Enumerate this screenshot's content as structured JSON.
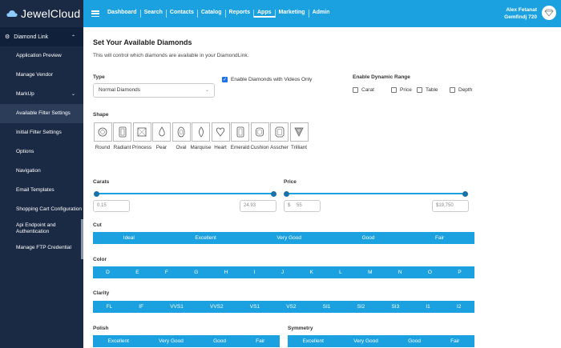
{
  "brand": {
    "name_a": "Jewel",
    "name_b": "Cloud"
  },
  "nav": [
    "Dashboard",
    "Search",
    "Contacts",
    "Catalog",
    "Reports",
    "Apps",
    "Marketing",
    "Admin"
  ],
  "user": {
    "name": "Alex Fetanat",
    "company": "Gemfindj 720"
  },
  "sidebar": {
    "header": "Diamond Link",
    "items": [
      {
        "label": "Application Preview"
      },
      {
        "label": "Manage Vendor"
      },
      {
        "label": "MarkUp"
      },
      {
        "label": "Available Filter Settings"
      },
      {
        "label": "Initial Filter Settings"
      },
      {
        "label": "Options"
      },
      {
        "label": "Navigation"
      },
      {
        "label": "Email Templates"
      },
      {
        "label": "Shopping Cart Configuration"
      },
      {
        "label": "Api Endpoint and Authentication"
      },
      {
        "label": "Manage FTP Credential"
      }
    ]
  },
  "main": {
    "title": "Set Your Available Diamonds",
    "description": "This will control which diamonds are available in your DiamondLink.",
    "type_label": "Type",
    "type_value": "Normal Diamonds",
    "videos_label": "Enable Diamonds with Videos Only",
    "dynamic_label": "Enable Dynamic Range",
    "dynamic_opts": [
      "Carat",
      "Price",
      "Table",
      "Depth"
    ],
    "shape_label": "Shape",
    "shapes": [
      "Round",
      "Radiant",
      "Princess",
      "Pear",
      "Oval",
      "Marquise",
      "Heart",
      "Emerald",
      "Cushion",
      "Asscher",
      "Trilliant"
    ],
    "carats_label": "Carats",
    "carat_min": "0.15",
    "carat_max": "24.93",
    "price_label": "Price",
    "price_currency": "$",
    "price_min": "55",
    "price_max": "$19,750",
    "cut_label": "Cut",
    "cut": [
      "Ideal",
      "Excellent",
      "Very Good",
      "Good",
      "Fair"
    ],
    "color_label": "Color",
    "color": [
      "D",
      "E",
      "F",
      "G",
      "H",
      "I",
      "J",
      "K",
      "L",
      "M",
      "N",
      "O",
      "P"
    ],
    "clarity_label": "Clarity",
    "clarity": [
      "FL",
      "IF",
      "VVS1",
      "VVS2",
      "VS1",
      "VS2",
      "SI1",
      "SI2",
      "SI3",
      "I1",
      "I2"
    ],
    "polish_label": "Polish",
    "polish": [
      "Excellent",
      "Very Good",
      "Good",
      "Fair"
    ],
    "symmetry_label": "Symmetry",
    "symmetry": [
      "Excellent",
      "Very Good",
      "Good",
      "Fair"
    ]
  },
  "colors": {
    "accent": "#1ba1df",
    "sidebar": "#1b2a44"
  }
}
